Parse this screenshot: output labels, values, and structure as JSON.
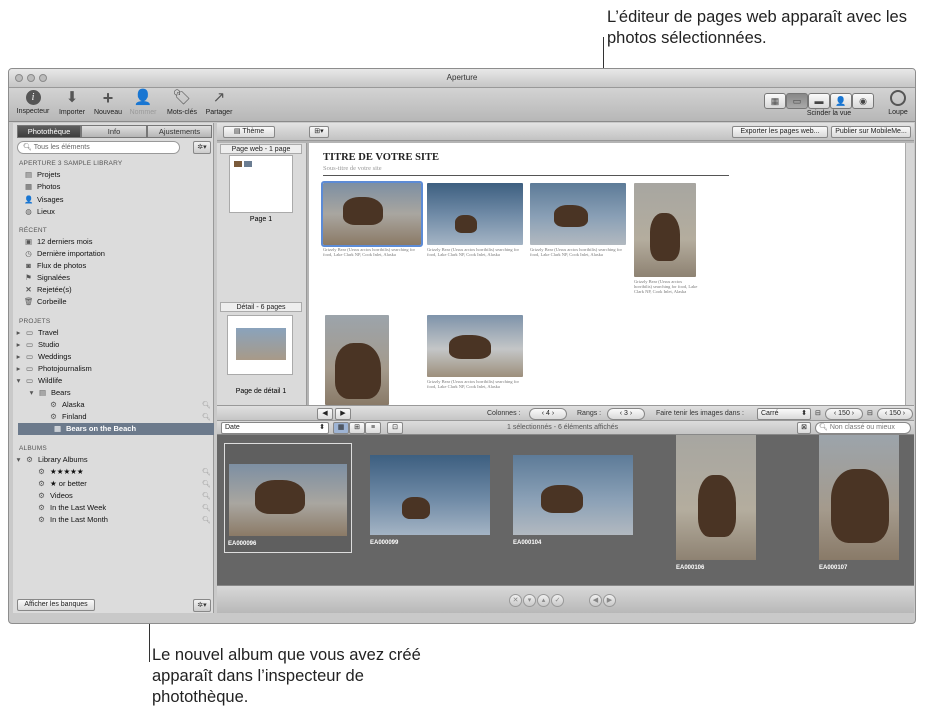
{
  "annotations": {
    "top": "L’éditeur de pages web apparaît avec les photos sélectionnées.",
    "bottom": "Le nouvel album que vous avez créé apparaît dans l’inspecteur de photothèque."
  },
  "window": {
    "title": "Aperture"
  },
  "toolbar": {
    "inspector": "Inspecteur",
    "import": "Importer",
    "new": "Nouveau",
    "name": "Nommer",
    "keywords": "Mots-clés",
    "share": "Partager",
    "split_view": "Scinder la vue",
    "loupe": "Loupe"
  },
  "inspector": {
    "tabs": [
      "Photothèque",
      "Info",
      "Ajustements"
    ],
    "search_placeholder": "Tous les éléments",
    "library_header": "APERTURE 3 SAMPLE LIBRARY",
    "library_items": [
      "Projets",
      "Photos",
      "Visages",
      "Lieux"
    ],
    "recent_header": "RÉCENT",
    "recent_items": [
      "12 derniers mois",
      "Dernière importation",
      "Flux de photos",
      "Signalées",
      "Rejetée(s)",
      "Corbeille"
    ],
    "projects_header": "PROJETS",
    "projects": [
      "Travel",
      "Studio",
      "Weddings",
      "Photojournalism",
      "Wildlife",
      "Bears",
      "Alaska",
      "Finland",
      "Bears on the Beach"
    ],
    "albums_header": "ALBUMS",
    "albums": [
      "Library Albums",
      "★★★★★",
      "★ or better",
      "Videos",
      "In the Last Week",
      "In the Last Month"
    ],
    "show_vaults": "Afficher les banques"
  },
  "webeditor": {
    "theme_button": "Thème",
    "export_button": "Exporter les pages web...",
    "publish_button": "Publier sur MobileMe...",
    "webpage_label": "Page web - 1 page",
    "page_label": "Page 1",
    "detail_label": "Détail - 6 pages",
    "detail_page_label": "Page de détail 1",
    "site_title": "TITRE DE VOTRE SITE",
    "site_subtitle": "Sous-titre de votre site",
    "caption": "Grizzly Bear (Ursus arctos horribilis) searching for food, Lake Clark NP, Cook Inlet, Alaska",
    "columns_label": "Colonnes :",
    "columns_value": "4",
    "rows_label": "Rangs :",
    "rows_value": "3",
    "fit_label": "Faire tenir les images dans :",
    "fit_value": "Carré",
    "width_value": "150",
    "height_value": "150"
  },
  "browser": {
    "sort": "Date",
    "status": "1 sélectionnés - 6 éléments affichés",
    "filter": "Non classé ou mieux",
    "photos": [
      "EA000096",
      "EA000099",
      "EA000104",
      "EA000106",
      "EA000107"
    ]
  }
}
